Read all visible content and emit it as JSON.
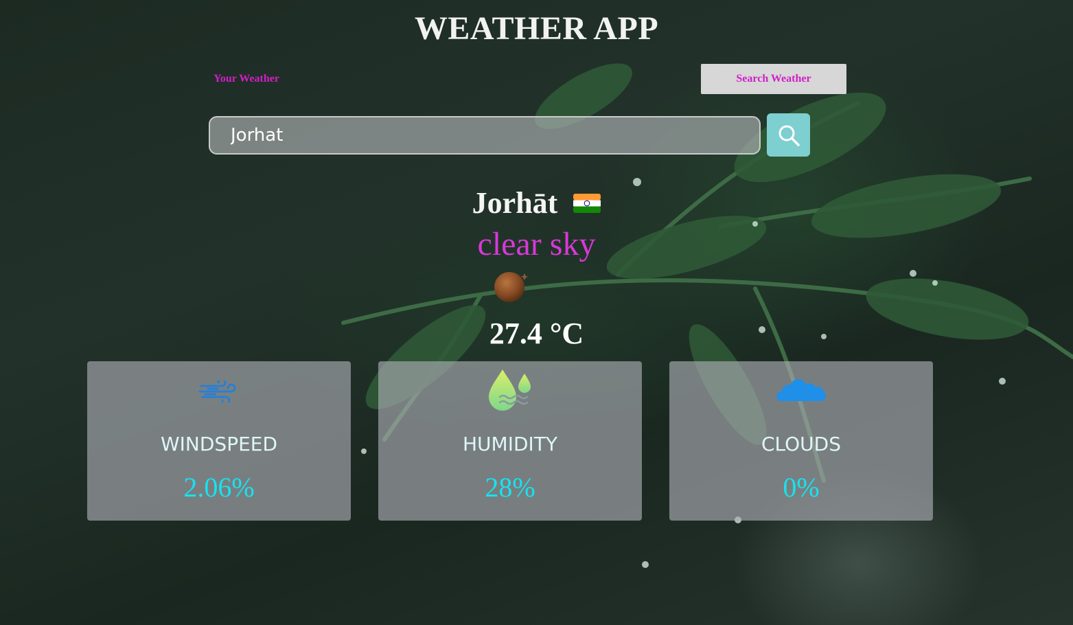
{
  "header": {
    "title": "WEATHER APP"
  },
  "tabs": {
    "your_weather": "Your Weather",
    "search_weather": "Search Weather"
  },
  "search": {
    "value": "Jorhat",
    "button_icon": "search-icon"
  },
  "weather": {
    "city": "Jorhāt",
    "flag_icon": "india-flag-icon",
    "description": "clear sky",
    "condition_icon": "clear-sky-icon",
    "temperature": "27.4 °C"
  },
  "cards": [
    {
      "icon": "wind-icon",
      "label": "WINDSPEED",
      "value": "2.06%"
    },
    {
      "icon": "humidity-icon",
      "label": "HUMIDITY",
      "value": "28%"
    },
    {
      "icon": "clouds-icon",
      "label": "CLOUDS",
      "value": "0%"
    }
  ],
  "colors": {
    "tab_text": "#d11fc9",
    "description": "#d838d8",
    "card_value": "#16e3ef",
    "search_button": "#7ecfd0"
  }
}
